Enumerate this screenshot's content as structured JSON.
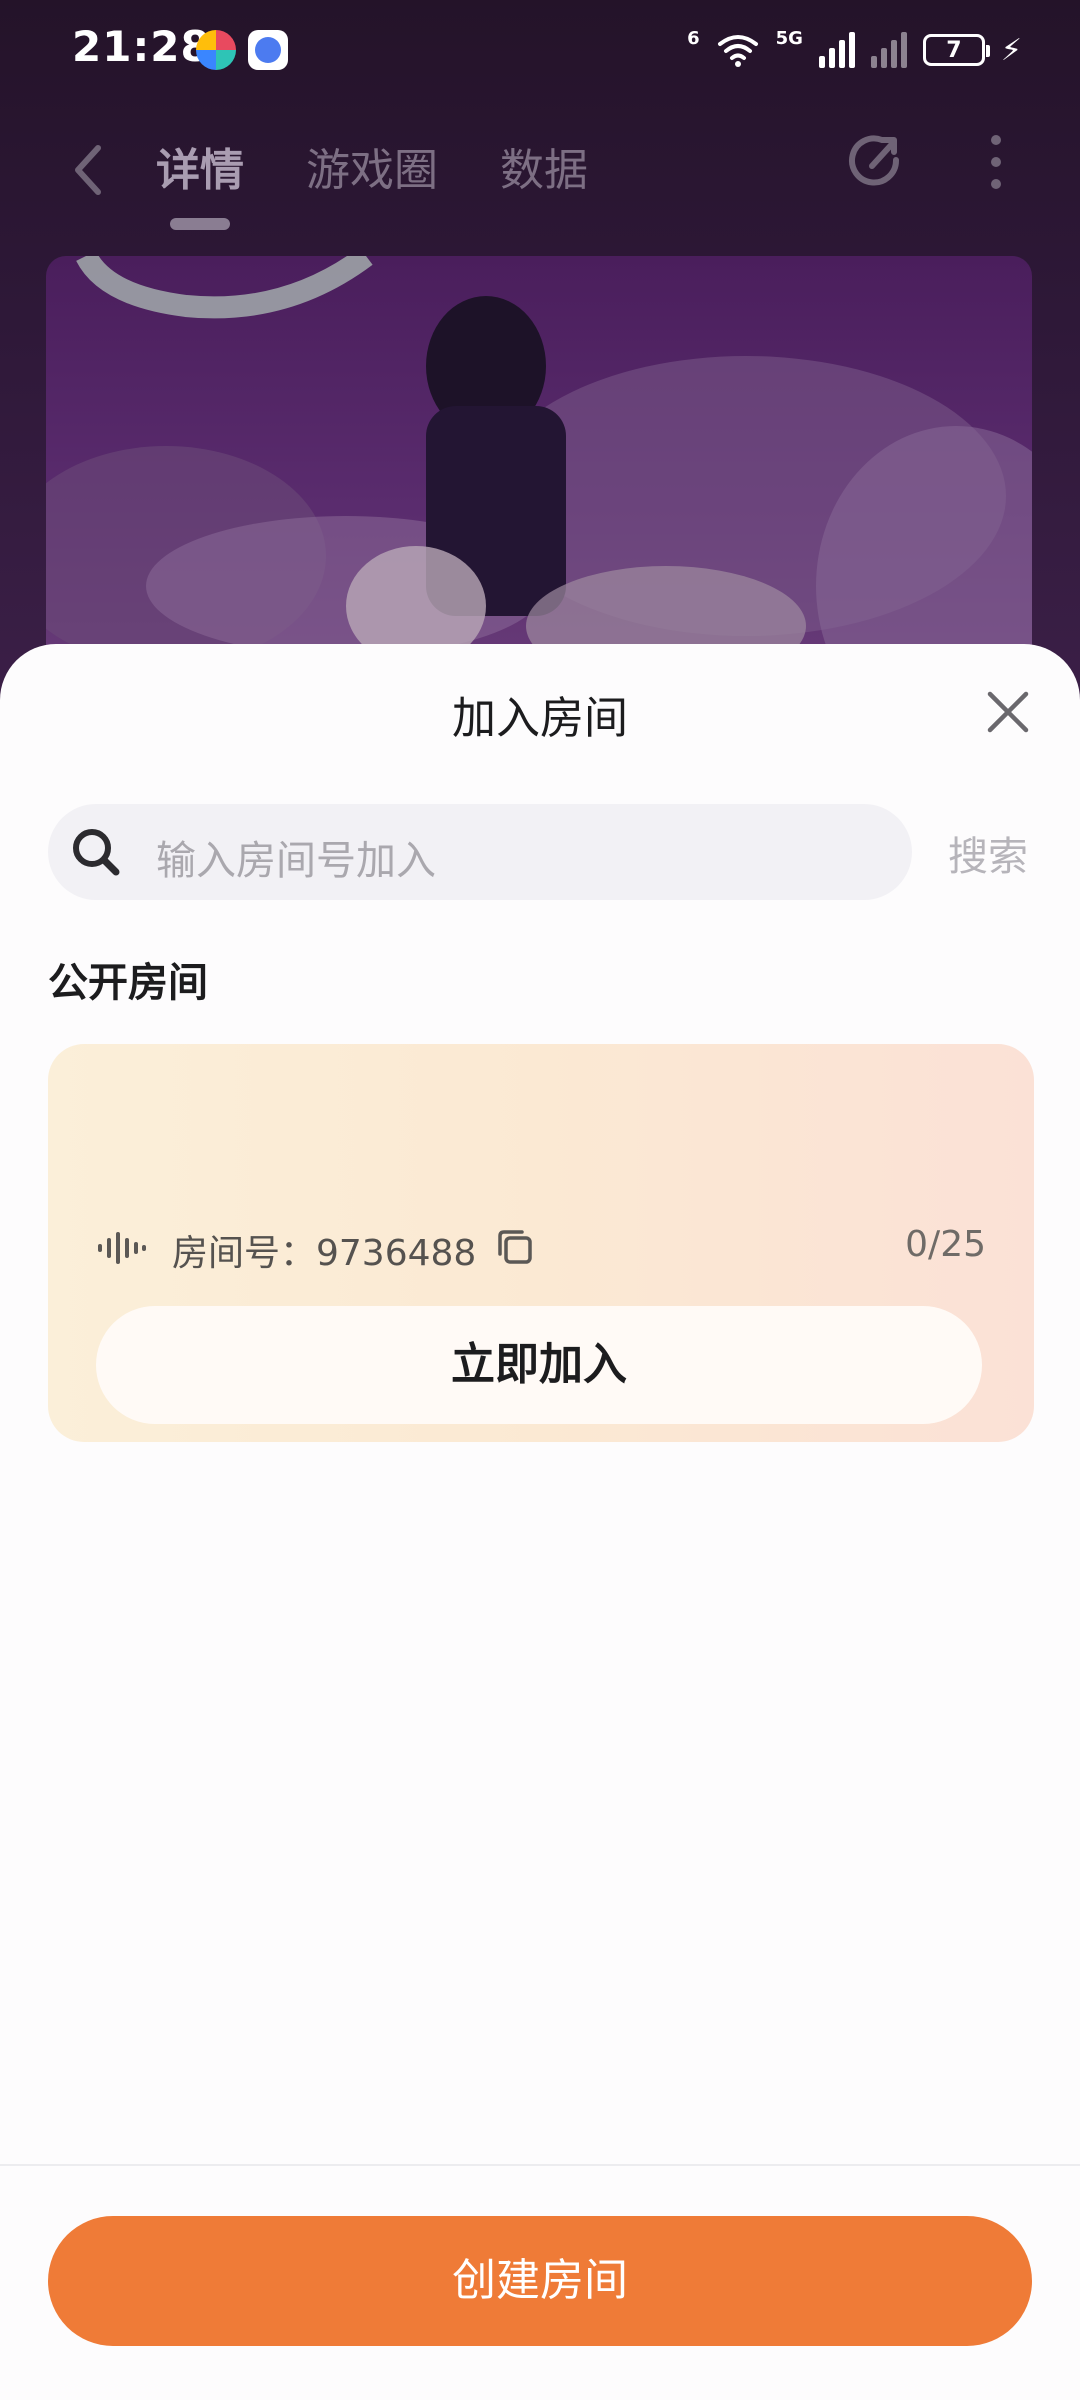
{
  "status_bar": {
    "time": "21:28",
    "battery_level": "7",
    "network_label": "5G",
    "wifi_label": "6"
  },
  "app_header": {
    "tabs": [
      {
        "label": "详情",
        "active": true
      },
      {
        "label": "游戏圈",
        "active": false
      },
      {
        "label": "数据",
        "active": false
      }
    ]
  },
  "sheet": {
    "title": "加入房间",
    "search": {
      "placeholder": "输入房间号加入",
      "button_label": "搜索"
    },
    "section_title": "公开房间",
    "rooms": [
      {
        "room_label": "房间号：9736488",
        "occupancy": "0/25",
        "join_label": "立即加入"
      }
    ],
    "create_label": "创建房间"
  },
  "colors": {
    "accent": "#ef7b37",
    "card_start": "#fbefd9",
    "card_end": "#fbe1d6"
  },
  "icons": [
    "back-icon",
    "share-icon",
    "more-icon",
    "close-icon",
    "search-icon",
    "voice-icon",
    "copy-icon"
  ]
}
